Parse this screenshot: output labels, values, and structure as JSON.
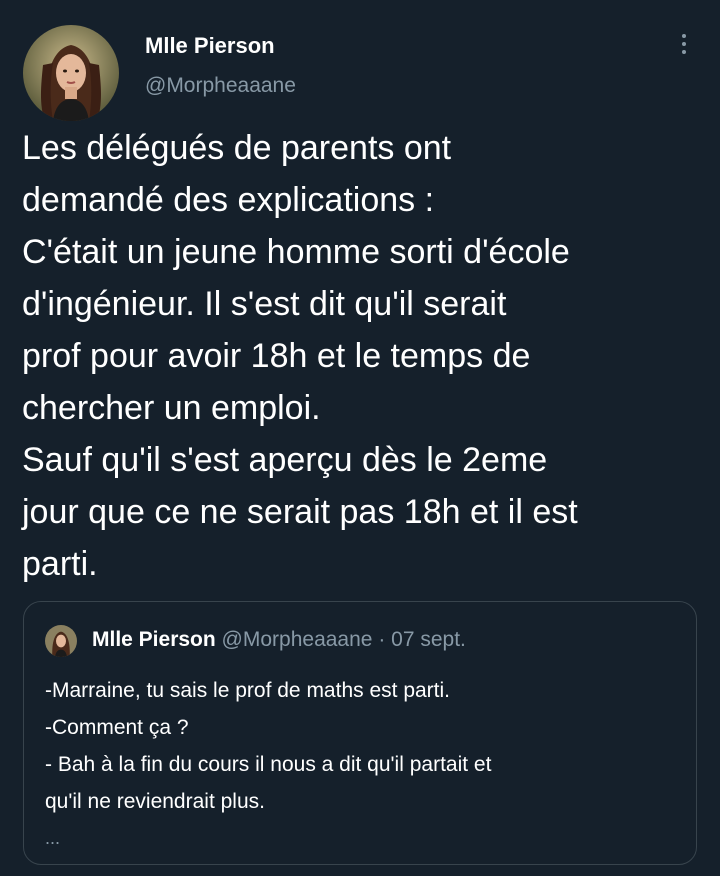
{
  "author": {
    "name": "Mlle Pierson",
    "handle": "@Morpheaaane"
  },
  "icons": {
    "more": "more-vertical-icon"
  },
  "tweet": {
    "lines": [
      "Les délégués de parents ont",
      "demandé des explications :",
      "C'était un jeune homme sorti d'école",
      "d'ingénieur. Il s'est dit qu'il serait",
      "prof pour avoir 18h et le temps de",
      "chercher un emploi.",
      "Sauf qu'il s'est aperçu dès le 2eme",
      "jour que ce ne serait pas 18h et il est",
      "parti."
    ]
  },
  "quoted": {
    "name": "Mlle Pierson",
    "handle": "@Morpheaaane",
    "separator": "·",
    "date": "07 sept.",
    "lines": [
      "-Marraine, tu sais le prof de maths est parti.",
      "-Comment ça ?",
      "- Bah à la fin  du cours il nous a dit qu'il partait et",
      "qu'il ne reviendrait plus."
    ],
    "ellipsis": "..."
  },
  "colors": {
    "background": "#15202b",
    "text": "#ffffff",
    "secondary": "#8899a6",
    "border": "#38444d"
  }
}
